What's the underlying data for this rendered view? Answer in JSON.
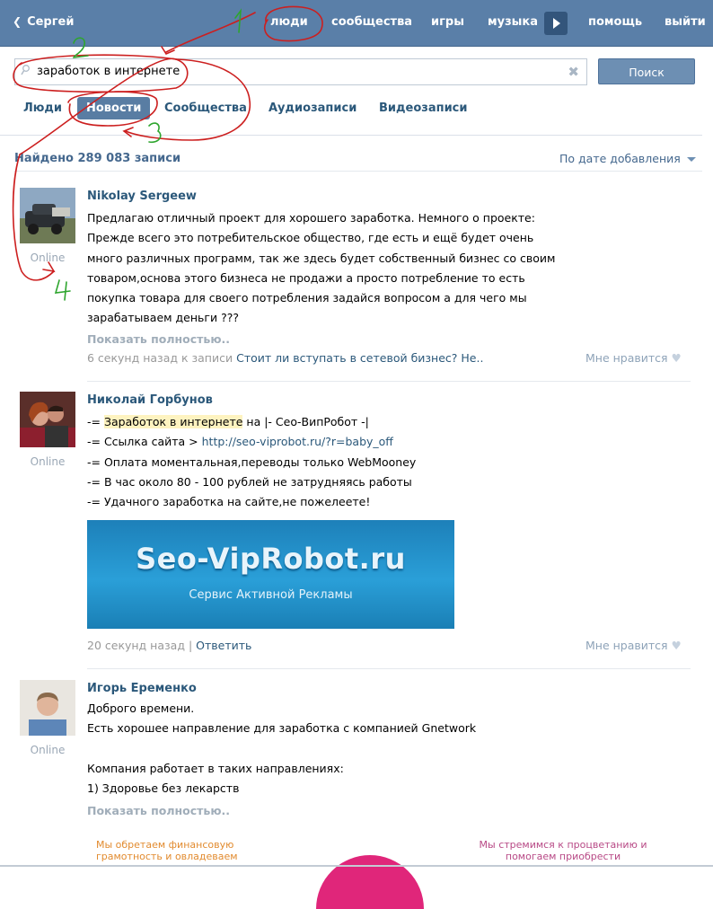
{
  "topnav": {
    "back_label": "Сергей",
    "items": [
      "люди",
      "сообщества",
      "игры",
      "музыка",
      "помощь",
      "выйти"
    ]
  },
  "search": {
    "value": "заработок в интернете",
    "button_label": "Поиск"
  },
  "tabs": [
    "Люди",
    "Новости",
    "Сообщества",
    "Аудиозаписи",
    "Видеозаписи"
  ],
  "active_tab": "Новости",
  "results": {
    "found_text": "Найдено 289 083 записи",
    "sort_label": "По дате добавления"
  },
  "posts": [
    {
      "author": "Nikolay Sergeew",
      "status": "Online",
      "lines": [
        "Предлагаю отличный проект для хорошего заработка. Немного о проекте:",
        "Прежде всего это потребительское общество, где есть и ещё будет очень",
        "много различных программ, так же здесь будет собственный бизнес со своим",
        "товаром,основа этого бизнеса не продажи а просто потребление то есть",
        "покупка товара для своего потребления задайся вопросом а для чего мы",
        "зарабатываем деньги ???"
      ],
      "more": "Показать полностью..",
      "time": "6 секунд назад к записи",
      "link": "Стоит ли вступать в сетевой бизнес? Не..",
      "like": "Мне нравится"
    },
    {
      "author": "Николай Горбунов",
      "status": "Online",
      "line1_a": "-= ",
      "line1_hl": "Заработок в интернете",
      "line1_b": " на |- Сео-ВипРобот -|",
      "line2_a": "-= Ссылка сайта > ",
      "line2_link": "http://seo-viprobot.ru/?r=baby_off",
      "line3": "-= Оплата моментальная,переводы только WebMooney",
      "line4": "-= В час около 80 - 100 рублей не затрудняясь работы",
      "line5": "-= Удачного заработка на сайте,не пожелеете!",
      "banner_title": "Seo-VipRobot.ru",
      "banner_subtitle": "Сервис Активной Рекламы",
      "time": "20 секунд назад",
      "reply": "Ответить",
      "separator": "|",
      "like": "Мне нравится"
    },
    {
      "author": "Игорь Еременко",
      "status": "Online",
      "lines": [
        "Доброго времени.",
        "Есть хорошее направление для заработка с компанией Gnetwork",
        "",
        "Компания работает в таких направлениях:",
        "1) Здоровье без лекарств"
      ],
      "more": "Показать полностью..",
      "ad_left": "Мы обретаем финансовую грамотность и овладеваем",
      "ad_right": "Мы стремимся к процветанию и помогаем приобрести"
    }
  ],
  "annotations": [
    "1",
    "2",
    "3",
    "4"
  ],
  "colors": {
    "header_bg": "#5a7fa8",
    "link": "#2b587a",
    "active_tab": "#597da3",
    "highlight": "#fef3c0",
    "annotation": "#cc1f1f",
    "annotation_digits": "#2ea52e"
  }
}
